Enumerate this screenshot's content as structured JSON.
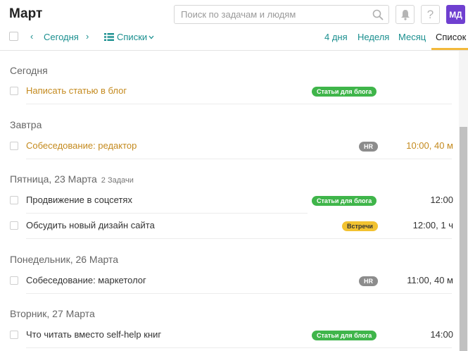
{
  "header": {
    "title": "Март",
    "search_placeholder": "Поиск по задачам и людям",
    "help_label": "?",
    "avatar_initials": "МД"
  },
  "toolbar": {
    "prev_label": "‹",
    "today_label": "Сегодня",
    "next_label": "›",
    "lists_label": "Списки",
    "views": [
      "4 дня",
      "Неделя",
      "Месяц",
      "Список"
    ],
    "active_view": "Список"
  },
  "days": [
    {
      "title": "Сегодня",
      "tasks": [
        {
          "name": "Написать статью в блог",
          "tag": "Статьи для блога",
          "tag_type": "blog",
          "time": "",
          "overdue": true
        }
      ]
    },
    {
      "title": "Завтра",
      "tasks": [
        {
          "name": "Собеседование: редактор",
          "tag": "HR",
          "tag_type": "hr",
          "time": "10:00, 40 м",
          "overdue": true
        }
      ]
    },
    {
      "title": "Пятница, 23 Марта",
      "count": "2 Задачи",
      "tasks": [
        {
          "name": "Продвижение в соцсетях",
          "tag": "Статьи для блога",
          "tag_type": "blog",
          "time": "12:00",
          "overdue": false
        },
        {
          "name": "Обсудить новый дизайн сайта",
          "tag": "Встречи",
          "tag_type": "meet",
          "time": "12:00, 1 ч",
          "overdue": false
        }
      ]
    },
    {
      "title": "Понедельник, 26 Марта",
      "tasks": [
        {
          "name": "Собеседование: маркетолог",
          "tag": "HR",
          "tag_type": "hr",
          "time": "11:00, 40 м",
          "overdue": false
        }
      ]
    },
    {
      "title": "Вторник, 27 Марта",
      "tasks": [
        {
          "name": "Что читать вместо self-help книг",
          "tag": "Статьи для блога",
          "tag_type": "blog",
          "time": "14:00",
          "overdue": false
        }
      ]
    }
  ],
  "colors": {
    "accent": "#1a8f8f",
    "overdue": "#c48a1e",
    "tag_blog": "#3fb54a",
    "tag_hr": "#8c8c8c",
    "tag_meet": "#f2c230",
    "avatar": "#6f3fd0",
    "active_tab_underline": "#f3b93b"
  }
}
